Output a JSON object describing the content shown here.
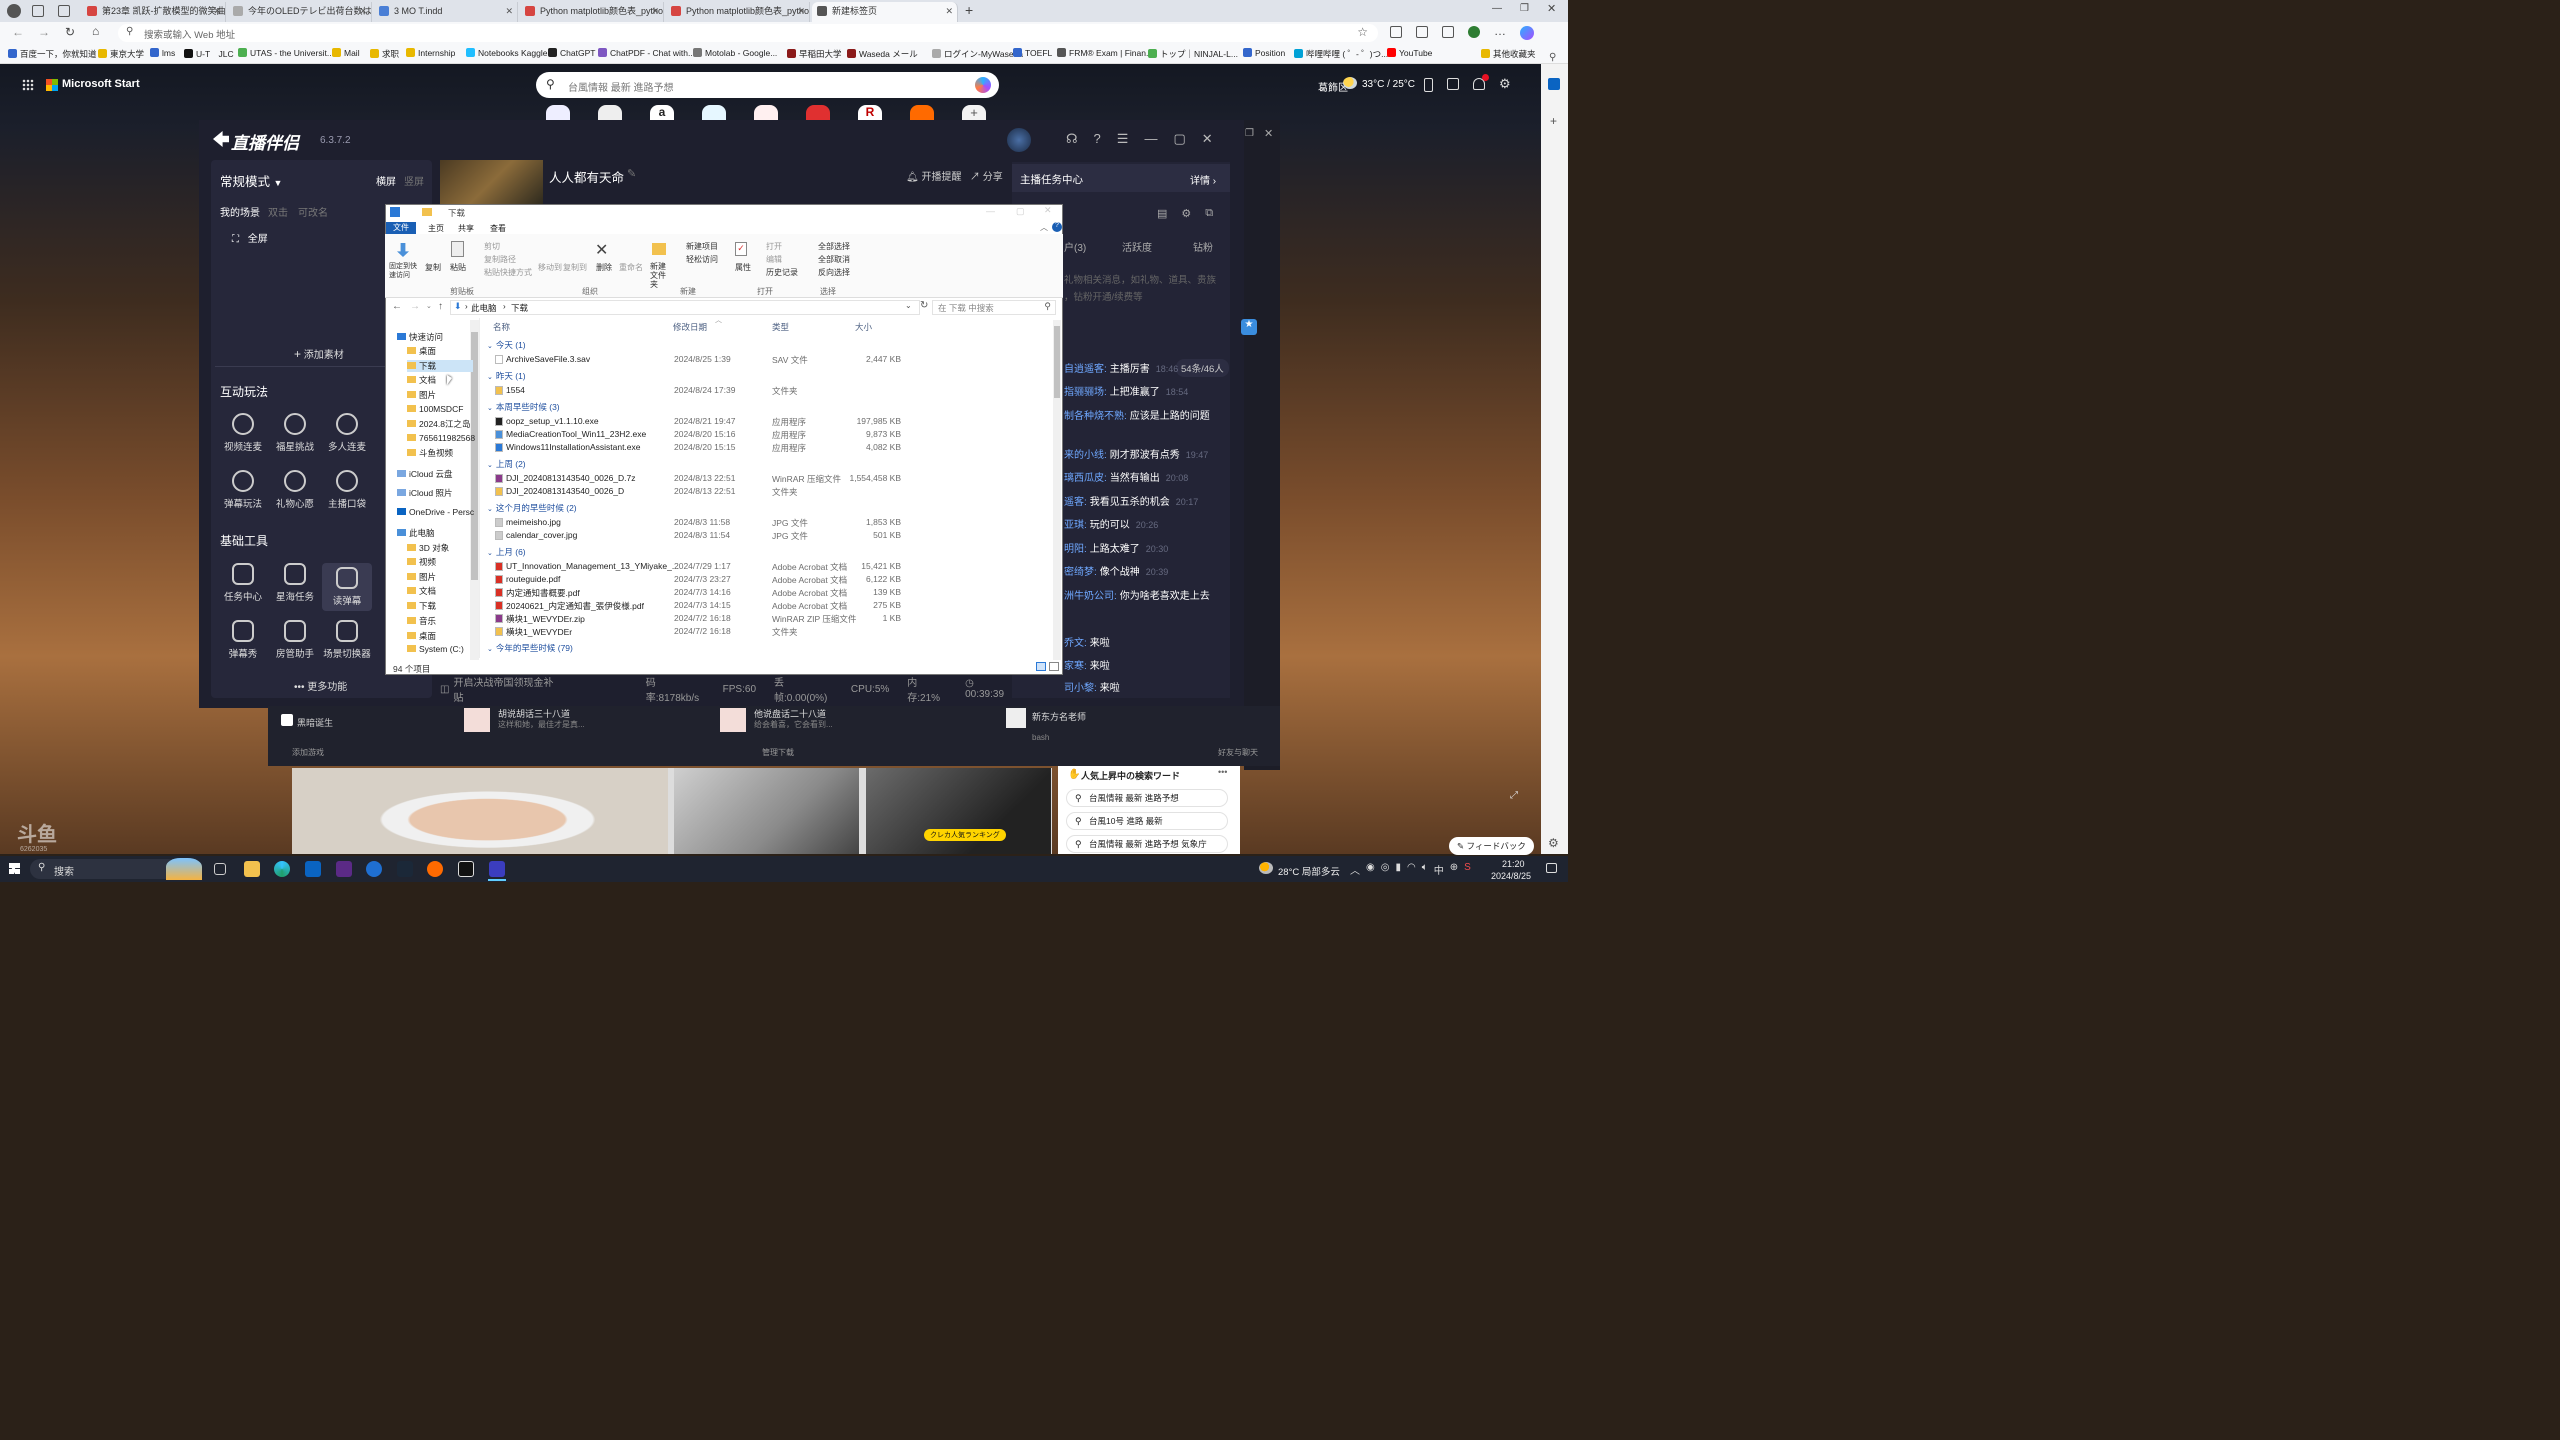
{
  "browser": {
    "tabs": [
      {
        "title": "第23章 凯跃-扩散模型的微笑曲线",
        "color": "#d64541"
      },
      {
        "title": "今年のOLEDテレビ出荷台数は約",
        "color": "#aaaaaa"
      },
      {
        "title": "3 MO T.indd",
        "color": "#4a7fd6"
      },
      {
        "title": "Python matplotlib颜色表_python",
        "color": "#d64541"
      },
      {
        "title": "Python matplotlib颜色表_python",
        "color": "#d64541"
      },
      {
        "title": "新建标签页",
        "color": "#555555"
      }
    ],
    "address_placeholder": "搜索或输入 Web 地址",
    "bookmarks": [
      {
        "label": "百度一下，你就知道",
        "color": "#3366cc"
      },
      {
        "label": "東京大学",
        "color": "#e8b800"
      },
      {
        "label": "lms",
        "color": "#3366cc"
      },
      {
        "label": "U-T　JLC",
        "color": "#111111"
      },
      {
        "label": "UTAS - the Universit...",
        "color": "#4caf50"
      },
      {
        "label": "Mail",
        "color": "#e8b800"
      },
      {
        "label": "求职",
        "color": "#e8b800"
      },
      {
        "label": "Internship",
        "color": "#e8b800"
      },
      {
        "label": "Notebooks Kaggle",
        "color": "#20beff"
      },
      {
        "label": "ChatGPT",
        "color": "#222222"
      },
      {
        "label": "ChatPDF - Chat with...",
        "color": "#7e57c2"
      },
      {
        "label": "Motolab - Google...",
        "color": "#777777"
      },
      {
        "label": "早稲田大学",
        "color": "#8b1a1a"
      },
      {
        "label": "Waseda メール",
        "color": "#8b1a1a"
      },
      {
        "label": "ログイン-MyWaseda",
        "color": "#aaaaaa"
      },
      {
        "label": "TOEFL",
        "color": "#3366cc"
      },
      {
        "label": "FRM® Exam | Finan...",
        "color": "#555555"
      },
      {
        "label": "トップ｜NINJAL-L...",
        "color": "#4caf50"
      },
      {
        "label": "Position",
        "color": "#3366cc"
      },
      {
        "label": "哔哩哔哩 ( ゜- ゜)つ...",
        "color": "#00a1d6"
      },
      {
        "label": "YouTube",
        "color": "#ff0000"
      },
      {
        "label": "其他收藏夹",
        "color": "#e8b800"
      }
    ]
  },
  "msn": {
    "brand": "Microsoft Start",
    "search_placeholder": "台風情報 最新 進路予想",
    "city": "葛飾区",
    "temp": "33°C / 25°C",
    "trending_title": "人気上昇中の検索ワード",
    "trending": [
      "台風情報 最新 進路予想",
      "台風10号 進路 最新",
      "台風情報 最新 進路予想 気象庁"
    ],
    "feedback": "フィードバック",
    "card_badge": "クレカ人気ランキング",
    "bottom_left": "添加游戏",
    "bottom_mid": "管理下载",
    "bottom_right": "好友与聊天",
    "items": [
      {
        "title": "胡说胡话三十八道",
        "sub": "这样和她，最佳才是真..."
      },
      {
        "title": "他说盘话二十八道",
        "sub": "给会着喜，它会看到..."
      },
      {
        "title": "新东方名老师",
        "sub": "bash"
      },
      {
        "title": "黑暗诞生",
        "sub": ""
      }
    ]
  },
  "live": {
    "logo": "直播伴侣",
    "version": "6.3.7.2",
    "mode": "常规模式",
    "orient_h": "横屏",
    "orient_v": "竖屏",
    "scenes_label": "我的场景",
    "scenes_hint1": "双击",
    "scenes_hint2": "可改名",
    "scene": "全屏",
    "add_material": "添加素材",
    "interactive_title": "互动玩法",
    "interactive": [
      "视频连麦",
      "福星挑战",
      "多人连麦",
      "弹幕玩法",
      "礼物心愿",
      "主播口袋"
    ],
    "tools_title": "基础工具",
    "tools": [
      "任务中心",
      "星海任务",
      "读弹幕",
      "弹幕秀",
      "房管助手",
      "场景切换器"
    ],
    "more": "更多功能",
    "stream_title": "人人都有天命",
    "notify": "开播提醒",
    "share": "分享",
    "task_center": "主播任务中心",
    "details": "详情",
    "tabs": [
      "户(3)",
      "活跃度",
      "钻粉"
    ],
    "tab_hint": "礼物相关消息，如礼物、道具、贵族",
    "tab_hint2": "，钻粉开通/续费等",
    "viewer_count": "54条/46人",
    "chats": [
      {
        "user": "自逍遥客:",
        "msg": "主播厉害",
        "time": "18:46"
      },
      {
        "user": "指骊骊场:",
        "msg": "上把准赢了",
        "time": "18:54"
      },
      {
        "user": "制各种烧不熟:",
        "msg": "应该是上路的问题",
        "time": ""
      },
      {
        "user": "来的小线:",
        "msg": "刚才那波有点秀",
        "time": "19:47"
      },
      {
        "user": "璃西瓜皮:",
        "msg": "当然有输出",
        "time": "20:08"
      },
      {
        "user": "遥客:",
        "msg": "我看见五杀的机会",
        "time": "20:17"
      },
      {
        "user": "亚琪:",
        "msg": "玩的可以",
        "time": "20:26"
      },
      {
        "user": "明阳:",
        "msg": "上路太难了",
        "time": "20:30"
      },
      {
        "user": "密绮梦:",
        "msg": "像个战神",
        "time": "20:39"
      },
      {
        "user": "洲牛奶公司:",
        "msg": "你为啥老喜欢走上去",
        "time": ""
      },
      {
        "user": "乔文:",
        "msg": "来啦",
        "time": ""
      },
      {
        "user": "家寒:",
        "msg": "来啦",
        "time": ""
      },
      {
        "user": "司小黎:",
        "msg": "来啦",
        "time": ""
      }
    ],
    "status_warn": "开启决战帝国领现金补贴",
    "bitrate": "码率:8178kb/s",
    "fps": "FPS:60",
    "drop": "丢帧:0.00(0%)",
    "cpu": "CPU:5%",
    "mem": "内存:21%",
    "duration": "00:39:39"
  },
  "explorer": {
    "title": "下载",
    "menu": [
      "文件",
      "主页",
      "共享",
      "查看"
    ],
    "ribbon": {
      "pin": "固定到快速访问",
      "copy": "复制",
      "paste": "粘贴",
      "cut": "剪切",
      "copy_path": "复制路径",
      "paste_shortcut": "粘贴快捷方式",
      "move_to": "移动到",
      "copy_to": "复制到",
      "delete": "删除",
      "rename": "重命名",
      "new_folder": "新建文件夹",
      "new_item": "新建项目",
      "easy_access": "轻松访问",
      "properties": "属性",
      "open": "打开",
      "edit": "编辑",
      "history": "历史记录",
      "select_all": "全部选择",
      "select_none": "全部取消",
      "invert": "反向选择",
      "groups": [
        "剪贴板",
        "组织",
        "新建",
        "打开",
        "选择"
      ]
    },
    "path": [
      "此电脑",
      "下载"
    ],
    "search_placeholder": "在 下载 中搜索",
    "columns": [
      "名称",
      "修改日期",
      "类型",
      "大小"
    ],
    "nav": [
      {
        "label": "快速访问",
        "indent": 0
      },
      {
        "label": "桌面",
        "indent": 1
      },
      {
        "label": "下载",
        "indent": 1
      },
      {
        "label": "文档",
        "indent": 1
      },
      {
        "label": "图片",
        "indent": 1
      },
      {
        "label": "100MSDCF",
        "indent": 1
      },
      {
        "label": "2024.8江之岛",
        "indent": 1
      },
      {
        "label": "765611982568",
        "indent": 1
      },
      {
        "label": "斗鱼视频",
        "indent": 1
      },
      {
        "label": "iCloud 云盘",
        "indent": 0
      },
      {
        "label": "iCloud 照片",
        "indent": 0
      },
      {
        "label": "OneDrive - Persc",
        "indent": 0
      },
      {
        "label": "此电脑",
        "indent": 0
      },
      {
        "label": "3D 对象",
        "indent": 1
      },
      {
        "label": "视频",
        "indent": 1
      },
      {
        "label": "图片",
        "indent": 1
      },
      {
        "label": "文档",
        "indent": 1
      },
      {
        "label": "下载",
        "indent": 1
      },
      {
        "label": "音乐",
        "indent": 1
      },
      {
        "label": "桌面",
        "indent": 1
      },
      {
        "label": "System (C:)",
        "indent": 1
      }
    ],
    "groups": [
      {
        "name": "今天 (1)",
        "files": [
          {
            "name": "ArchiveSaveFile.3.sav",
            "date": "2024/8/25 1:39",
            "type": "SAV 文件",
            "size": "2,447 KB",
            "icon": "#ffffff"
          }
        ]
      },
      {
        "name": "昨天 (1)",
        "files": [
          {
            "name": "1554",
            "date": "2024/8/24 17:39",
            "type": "文件夹",
            "size": "",
            "icon": "#f2c14e"
          }
        ]
      },
      {
        "name": "本周早些时候 (3)",
        "files": [
          {
            "name": "oopz_setup_v1.1.10.exe",
            "date": "2024/8/21 19:47",
            "type": "应用程序",
            "size": "197,985 KB",
            "icon": "#222222"
          },
          {
            "name": "MediaCreationTool_Win11_23H2.exe",
            "date": "2024/8/20 15:16",
            "type": "应用程序",
            "size": "9,873 KB",
            "icon": "#4a90d9"
          },
          {
            "name": "Windows11InstallationAssistant.exe",
            "date": "2024/8/20 15:15",
            "type": "应用程序",
            "size": "4,082 KB",
            "icon": "#2b79d6"
          }
        ]
      },
      {
        "name": "上周 (2)",
        "files": [
          {
            "name": "DJI_20240813143540_0026_D.7z",
            "date": "2024/8/13 22:51",
            "type": "WinRAR 压缩文件",
            "size": "1,554,458 KB",
            "icon": "#8b3a8b"
          },
          {
            "name": "DJI_20240813143540_0026_D",
            "date": "2024/8/13 22:51",
            "type": "文件夹",
            "size": "",
            "icon": "#f2c14e"
          }
        ]
      },
      {
        "name": "这个月的早些时候 (2)",
        "files": [
          {
            "name": "meimeisho.jpg",
            "date": "2024/8/3 11:58",
            "type": "JPG 文件",
            "size": "1,853 KB",
            "icon": "#cccccc"
          },
          {
            "name": "calendar_cover.jpg",
            "date": "2024/8/3 11:54",
            "type": "JPG 文件",
            "size": "501 KB",
            "icon": "#cccccc"
          }
        ]
      },
      {
        "name": "上月 (6)",
        "files": [
          {
            "name": "UT_Innovation_Management_13_YMiyake_...",
            "date": "2024/7/29 1:17",
            "type": "Adobe Acrobat 文档",
            "size": "15,421 KB",
            "icon": "#d93025"
          },
          {
            "name": "routeguide.pdf",
            "date": "2024/7/3 23:27",
            "type": "Adobe Acrobat 文档",
            "size": "6,122 KB",
            "icon": "#d93025"
          },
          {
            "name": "内定通知書概要.pdf",
            "date": "2024/7/3 14:16",
            "type": "Adobe Acrobat 文档",
            "size": "139 KB",
            "icon": "#d93025"
          },
          {
            "name": "20240621_内定通知書_張伊俊様.pdf",
            "date": "2024/7/3 14:15",
            "type": "Adobe Acrobat 文档",
            "size": "275 KB",
            "icon": "#d93025"
          },
          {
            "name": "横块1_WEVYDEr.zip",
            "date": "2024/7/2 16:18",
            "type": "WinRAR ZIP 压缩文件",
            "size": "1 KB",
            "icon": "#8b3a8b"
          },
          {
            "name": "横块1_WEVYDEr",
            "date": "2024/7/2 16:18",
            "type": "文件夹",
            "size": "",
            "icon": "#f2c14e"
          }
        ]
      },
      {
        "name": "今年的早些时候 (79)",
        "files": []
      }
    ],
    "status": "94 个项目"
  },
  "taskbar": {
    "search": "搜索",
    "weather": "28°C 局部多云",
    "ime": "中",
    "time": "21:20",
    "date": "2024/8/25"
  },
  "desktop_watermark": "斗鱼",
  "desktop_sub": "6262035"
}
